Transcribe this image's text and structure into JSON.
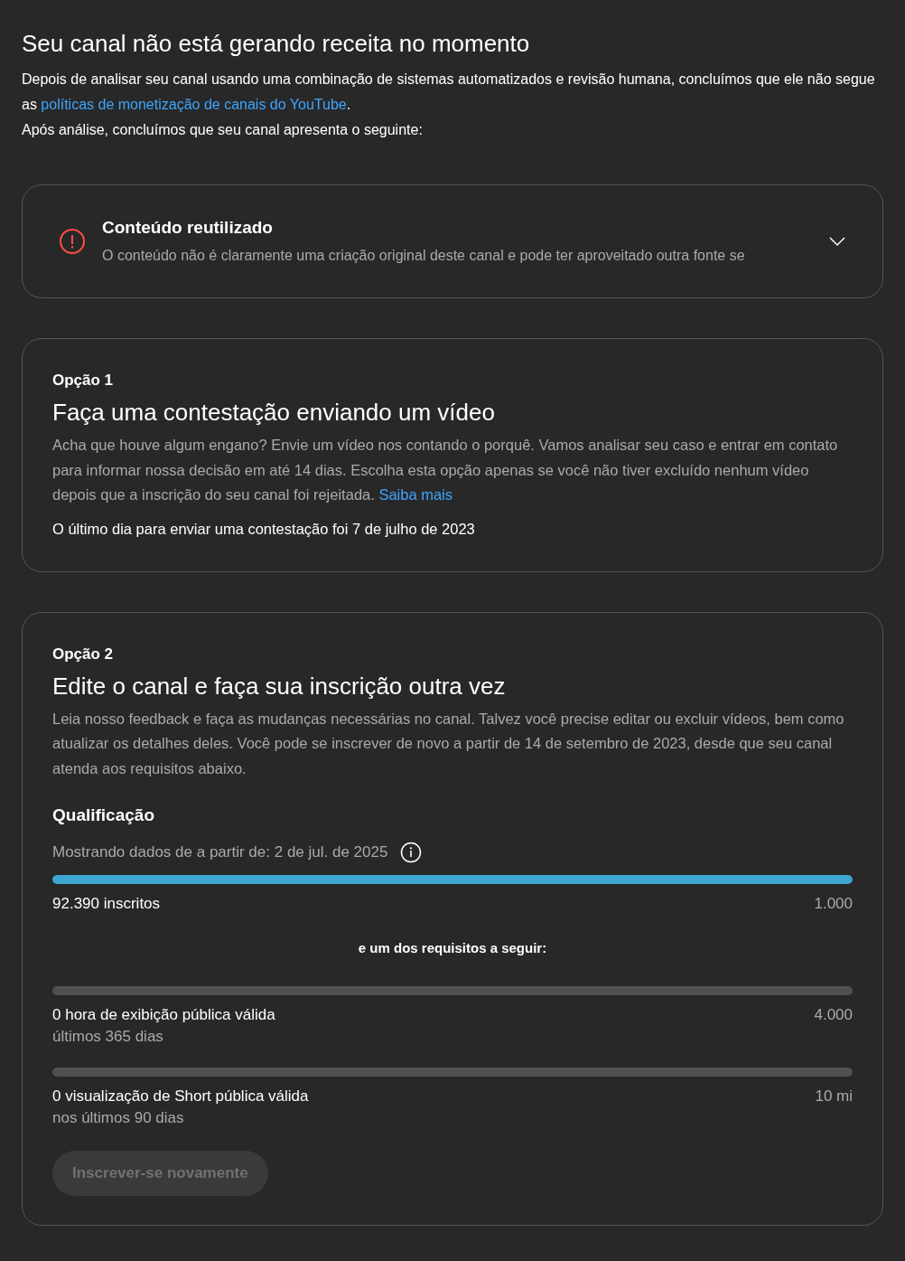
{
  "header": {
    "title": "Seu canal não está gerando receita no momento",
    "text_before": "Depois de analisar seu canal usando uma combinação de sistemas automatizados e revisão humana, concluímos que ele não segue as",
    "link": "políticas de monetização de canais do YouTube",
    "text_after": ".",
    "summary": "Após análise, concluímos que seu canal apresenta o seguinte:"
  },
  "issue": {
    "title": "Conteúdo reutilizado",
    "description": "O conteúdo não é claramente uma criação original deste canal e pode ter aproveitado outra fonte se",
    "expanded": false
  },
  "option1": {
    "label": "Opção 1",
    "title": "Faça uma contestação enviando um vídeo",
    "description": "Acha que houve algum engano? Envie um vídeo nos contando o porquê. Vamos analisar seu caso e entrar em contato para informar nossa decisão em até 14 dias. Escolha esta opção apenas se você não tiver excluído nenhum vídeo depois que a inscrição do seu canal foi rejeitada.",
    "link": "Saiba mais",
    "note": "O último dia para enviar uma contestação foi 7 de julho de 2023"
  },
  "option2": {
    "label": "Opção 2",
    "title": "Edite o canal e faça sua inscrição outra vez",
    "description": "Leia nosso feedback e faça as mudanças necessárias no canal. Talvez você precise editar ou excluir vídeos, bem como atualizar os detalhes deles. Você pode se inscrever de novo a partir de 14 de setembro de 2023, desde que seu canal atenda aos requisitos abaixo.",
    "qualification_title": "Qualificação",
    "data_note": "Mostrando dados de a partir de: 2 de jul. de 2025",
    "requirements": [
      {
        "kind": "main",
        "level": 1,
        "label": "92.390 inscritos",
        "target": "1.000"
      },
      {
        "kind": "separator",
        "text": "e um dos requisitos a seguir:"
      },
      {
        "kind": "alt",
        "level": 0,
        "label": "0 hora de exibição pública válida",
        "sublabel": "últimos 365 dias",
        "target": "4.000"
      },
      {
        "kind": "alt",
        "level": 0,
        "label": "0 visualização de Short pública válida",
        "sublabel": "nos últimos 90 dias",
        "target": "10 mi"
      }
    ],
    "button": {
      "label": "Inscrever-se novamente",
      "disabled": true
    }
  }
}
